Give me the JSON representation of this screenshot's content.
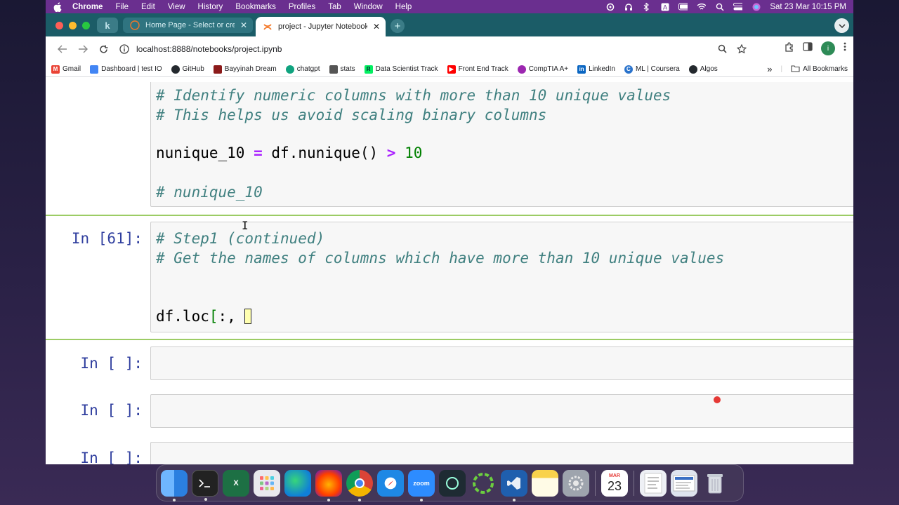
{
  "menubar": {
    "app": "Chrome",
    "items": [
      "File",
      "Edit",
      "View",
      "History",
      "Bookmarks",
      "Profiles",
      "Tab",
      "Window",
      "Help"
    ],
    "clock": "Sat 23 Mar  10:15 PM"
  },
  "tabs": {
    "pinned_letter": "k",
    "inactive_title": "Home Page - Select or create",
    "active_title": "project - Jupyter Notebook"
  },
  "toolbar": {
    "url": "localhost:8888/notebooks/project.ipynb",
    "avatar_letter": "i"
  },
  "bookmarks": {
    "items": [
      {
        "label": "Gmail",
        "color": "#ea4335"
      },
      {
        "label": "Dashboard | test IO",
        "color": "#4285f4"
      },
      {
        "label": "GitHub",
        "color": "#24292e"
      },
      {
        "label": "Bayyinah Dream",
        "color": "#8b1a1a"
      },
      {
        "label": "chatgpt",
        "color": "#10a37f"
      },
      {
        "label": "stats",
        "color": "#555555"
      },
      {
        "label": "Data Scientist Track",
        "color": "#03ef62"
      },
      {
        "label": "Front End Track",
        "color": "#ff0000"
      },
      {
        "label": "CompTIA A+",
        "color": "#9c27b0"
      },
      {
        "label": "LinkedIn",
        "color": "#0a66c2"
      },
      {
        "label": "ML | Coursera",
        "color": "#2a73cc"
      },
      {
        "label": "Algos",
        "color": "#24292e"
      }
    ],
    "more": "»",
    "all_bookmarks": "All Bookmarks"
  },
  "notebook": {
    "cell1": {
      "line1": "# Identify numeric columns with more than 10 unique values",
      "line2": "# This helps us avoid scaling binary columns",
      "line3_var": "nunique_10",
      "line3_eq": "=",
      "line3_call": "df.nunique()",
      "line3_op": ">",
      "line3_num": "10",
      "line4": "# nunique_10"
    },
    "cell2": {
      "prompt": "In [61]:",
      "line1": "# Step1 (continued)",
      "line2": "# Get the names of columns which have more than 10 unique values",
      "line3_a": "df.loc",
      "line3_b": "[",
      "line3_c": ":, "
    },
    "cell3": {
      "prompt": "In [ ]:"
    },
    "cell4": {
      "prompt": "In [ ]:"
    },
    "cell5": {
      "prompt": "In [ ]:"
    }
  },
  "dock": {
    "calendar_month": "MAR",
    "calendar_day": "23",
    "zoom_label": "zoom"
  }
}
